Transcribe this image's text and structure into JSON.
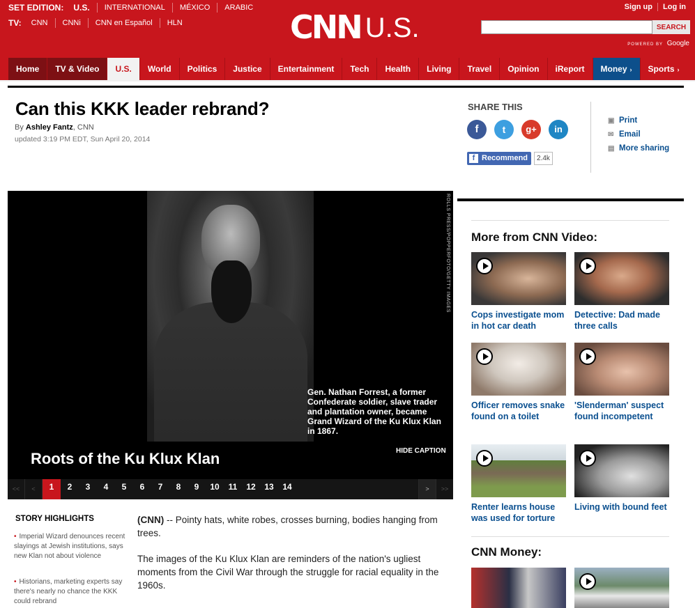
{
  "header": {
    "edition_label": "SET EDITION:",
    "edition_current": "U.S.",
    "editions": [
      "INTERNATIONAL",
      "MÉXICO",
      "ARABIC"
    ],
    "tv_label": "TV:",
    "tv_links": [
      "CNN",
      "CNNi",
      "CNN en Español",
      "HLN"
    ],
    "logo": "CNN",
    "section_logo": "U.S.",
    "signup": "Sign up",
    "login": "Log in",
    "search_button": "SEARCH",
    "powered_small": "POWERED BY",
    "powered_brand": "Google"
  },
  "nav": {
    "items": [
      "Home",
      "TV & Video",
      "U.S.",
      "World",
      "Politics",
      "Justice",
      "Entertainment",
      "Tech",
      "Health",
      "Living",
      "Travel",
      "Opinion",
      "iReport",
      "Money",
      "Sports"
    ],
    "chevron": "›"
  },
  "article": {
    "title": "Can this KKK leader rebrand?",
    "by_prefix": "By",
    "author": "Ashley Fantz",
    "outlet": ", CNN",
    "updated": "updated 3:19 PM EDT, Sun April 20, 2014",
    "dateline": "(CNN)",
    "para1": " -- Pointy hats, white robes, crosses burning, bodies hanging from trees.",
    "para2": "The images of the Ku Klux Klan are reminders of the nation's ugliest moments from the Civil War through the struggle for racial equality in the 1960s."
  },
  "share": {
    "heading": "SHARE THIS",
    "icons": [
      "f",
      "t",
      "g+",
      "in"
    ],
    "recommend_label": "Recommend",
    "recommend_count": "2.4k",
    "print": "Print",
    "email": "Email",
    "more": "More sharing"
  },
  "gallery": {
    "credit": "ROLLS PRESS/POPPERFOTO/GETTY IMAGES",
    "caption": "Gen. Nathan Forrest, a former Confederate soldier, slave trader and plantation owner, became Grand Wizard of the Ku Klux Klan in 1867.",
    "title": "Roots of the Ku Klux Klan",
    "hide_caption": "HIDE CAPTION",
    "first": "<<",
    "prev": "<",
    "next": ">",
    "last": ">>",
    "pages": [
      "1",
      "2",
      "3",
      "4",
      "5",
      "6",
      "7",
      "8",
      "9",
      "10",
      "11",
      "12",
      "13",
      "14"
    ],
    "current_page": 1
  },
  "highlights": {
    "heading": "STORY HIGHLIGHTS",
    "items": [
      "Imperial Wizard denounces recent slayings at Jewish institutions, says new Klan not about violence",
      "Historians, marketing experts say there's nearly no chance the KKK could rebrand"
    ]
  },
  "sidebar": {
    "video_heading": "More from CNN Video:",
    "videos": [
      "Cops investigate mom in hot car death",
      "Detective: Dad made three calls",
      "Officer removes snake found on a toilet",
      "'Slenderman' suspect found incompetent",
      "Renter learns house was used for torture",
      "Living with bound feet"
    ],
    "money_heading": "CNN Money:"
  },
  "colors": {
    "brand_red": "#c8161d",
    "link_blue": "#0a4f8f",
    "money_blue": "#0d4f8b"
  }
}
